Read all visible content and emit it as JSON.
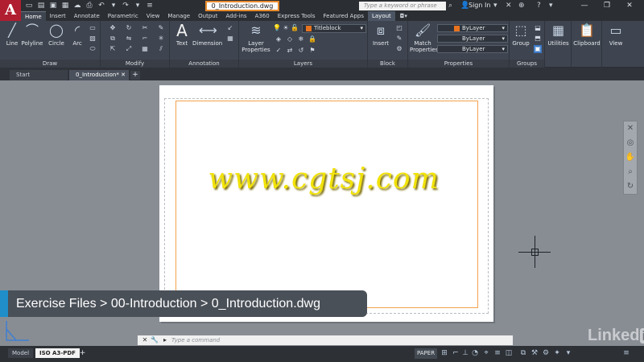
{
  "app": {
    "logo_letter": "A"
  },
  "titlebar": {
    "document_title": "0_Introduction.dwg",
    "search_placeholder": "Type a keyword or phrase",
    "sign_in": "Sign In"
  },
  "ribbon_tabs": [
    "Home",
    "Insert",
    "Annotate",
    "Parametric",
    "View",
    "Manage",
    "Output",
    "Add-ins",
    "A360",
    "Express Tools",
    "Featured Apps",
    "Layout"
  ],
  "ribbon": {
    "draw": {
      "title": "Draw",
      "tools": [
        "Line",
        "Polyline",
        "Circle",
        "Arc"
      ]
    },
    "modify": {
      "title": "Modify"
    },
    "annotation": {
      "title": "Annotation",
      "tools": [
        "Text",
        "Dimension"
      ]
    },
    "layers": {
      "title": "Layers",
      "layer_properties": "Layer Properties",
      "current_layer": "Titleblock",
      "layer_color": "#e8731e"
    },
    "block": {
      "title": "Block",
      "insert": "Insert"
    },
    "properties": {
      "title": "Properties",
      "match_properties": "Match Properties",
      "color": "ByLayer",
      "linetype": "ByLayer",
      "lineweight": "ByLayer"
    },
    "groups": {
      "title": "Groups",
      "group": "Group"
    },
    "utilities": "Utilities",
    "clipboard": "Clipboard",
    "view": "View"
  },
  "file_tabs": {
    "start": "Start",
    "current": "0_Introduction*"
  },
  "drawing": {
    "watermark": "www.cgtsj.com"
  },
  "breadcrumb": {
    "path": "Exercise Files > 00-Introduction > 0_Introduction.dwg"
  },
  "command_line": {
    "placeholder": "Type a command"
  },
  "status": {
    "tabs": [
      "Model",
      "ISO A3-PDF"
    ],
    "space": "PAPER"
  },
  "brand_watermark": {
    "text": "Linked",
    "in": "in"
  }
}
